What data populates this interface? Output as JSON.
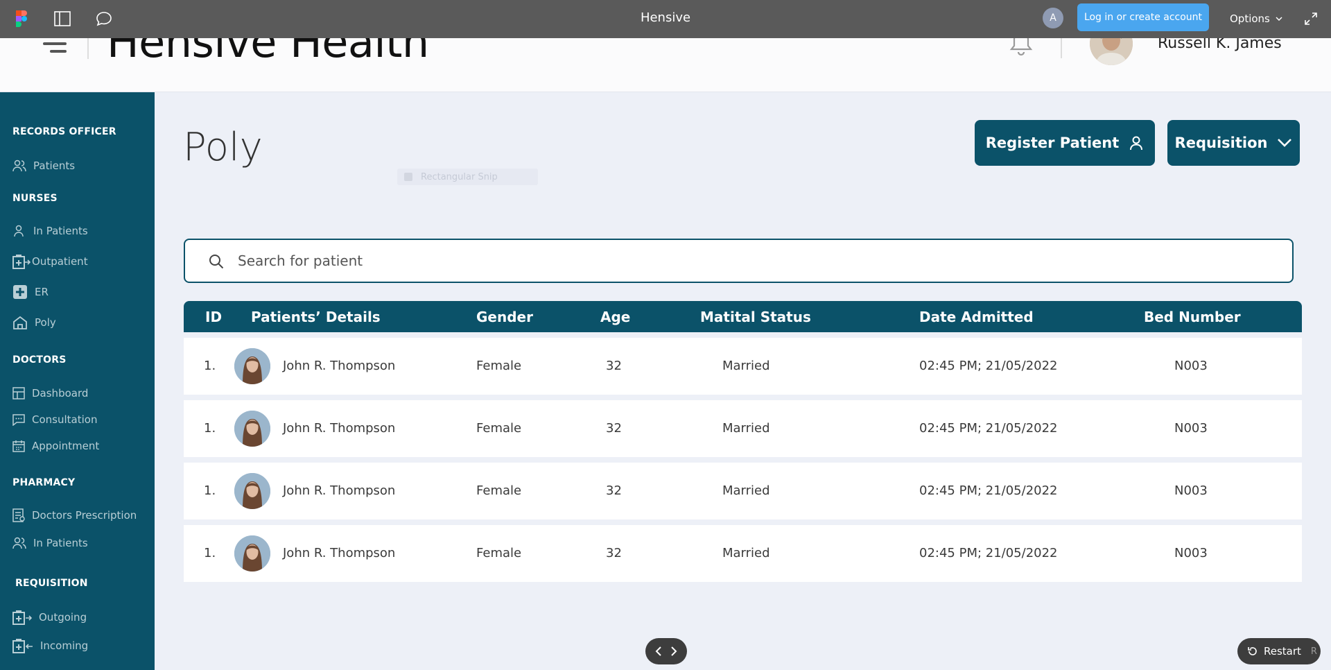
{
  "figma_bar": {
    "title": "Hensive",
    "avatar_letter": "A",
    "login_label": "Log in or create account",
    "options_label": "Options"
  },
  "header": {
    "app_title": "Hensive Health",
    "user_name": "Russell K. James"
  },
  "sidebar": {
    "sections": [
      {
        "label": "RECORDS OFFICER",
        "items": [
          {
            "label": "Patients",
            "icon": "users-icon"
          }
        ]
      },
      {
        "label": "NURSES",
        "items": [
          {
            "label": "In Patients",
            "icon": "user-icon"
          },
          {
            "label": "Outpatient",
            "icon": "box-arrow-out-icon"
          },
          {
            "label": "ER",
            "icon": "medical-cross-icon"
          },
          {
            "label": "Poly",
            "icon": "home-icon"
          }
        ]
      },
      {
        "label": "DOCTORS",
        "items": [
          {
            "label": "Dashboard",
            "icon": "dashboard-icon"
          },
          {
            "label": "Consultation",
            "icon": "chat-icon"
          },
          {
            "label": "Appointment",
            "icon": "calendar-icon"
          }
        ]
      },
      {
        "label": "PHARMACY",
        "items": [
          {
            "label": "Doctors Prescription",
            "icon": "prescription-icon"
          },
          {
            "label": "In Patients",
            "icon": "users-icon"
          }
        ]
      },
      {
        "label": "REQUISITION",
        "items": [
          {
            "label": "Outgoing",
            "icon": "box-arrow-out-icon"
          },
          {
            "label": "Incoming",
            "icon": "box-arrow-in-icon"
          }
        ]
      }
    ]
  },
  "main": {
    "page_title": "Poly",
    "ghost_label": "Rectangular Snip",
    "register_label": "Register Patient",
    "requisition_label": "Requisition",
    "search_placeholder": "Search for patient"
  },
  "table": {
    "headers": [
      "ID",
      "Patients’ Details",
      "Gender",
      "Age",
      "Matital Status",
      "Date Admitted",
      "Bed Number"
    ],
    "rows": [
      {
        "id": "1.",
        "name": "John R. Thompson",
        "gender": "Female",
        "age": "32",
        "status": "Married",
        "date": "02:45 PM; 21/05/2022",
        "bed": "N003"
      },
      {
        "id": "1.",
        "name": "John R. Thompson",
        "gender": "Female",
        "age": "32",
        "status": "Married",
        "date": "02:45 PM; 21/05/2022",
        "bed": "N003"
      },
      {
        "id": "1.",
        "name": "John R. Thompson",
        "gender": "Female",
        "age": "32",
        "status": "Married",
        "date": "02:45 PM; 21/05/2022",
        "bed": "N003"
      },
      {
        "id": "1.",
        "name": "John R. Thompson",
        "gender": "Female",
        "age": "32",
        "status": "Married",
        "date": "02:45 PM; 21/05/2022",
        "bed": "N003"
      }
    ]
  },
  "footer": {
    "restart_label": "Restart",
    "restart_key": "R"
  },
  "colors": {
    "primary": "#0b5269",
    "background": "#edf0f7",
    "figma_bar": "#5a5a5a",
    "login_button": "#4aa6ef"
  }
}
